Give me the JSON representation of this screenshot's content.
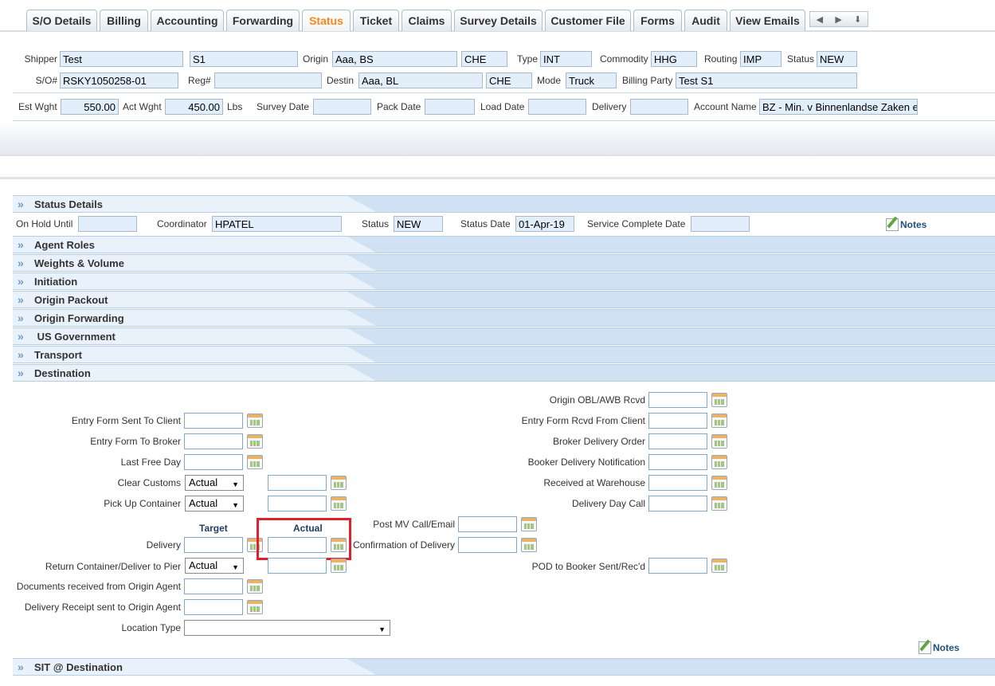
{
  "tabs": [
    {
      "label": "S/O Details",
      "active": false
    },
    {
      "label": "Billing",
      "active": false
    },
    {
      "label": "Accounting",
      "active": false
    },
    {
      "label": "Forwarding",
      "active": false
    },
    {
      "label": "Status",
      "active": true
    },
    {
      "label": "Ticket",
      "active": false
    },
    {
      "label": "Claims",
      "active": false
    },
    {
      "label": "Survey Details",
      "active": false
    },
    {
      "label": "Customer File",
      "active": false
    },
    {
      "label": "Forms",
      "active": false
    },
    {
      "label": "Audit",
      "active": false
    },
    {
      "label": "View Emails",
      "active": false
    }
  ],
  "nav": {
    "prev": "◀",
    "next": "▶",
    "down": "⬇"
  },
  "header": {
    "shipper_label": "Shipper",
    "shipper": "Test",
    "shipper2": "S1",
    "origin_label": "Origin",
    "origin": "Aaa, BS",
    "origin_country": "CHE",
    "type_label": "Type",
    "type": "INT",
    "commodity_label": "Commodity",
    "commodity": "HHG",
    "routing_label": "Routing",
    "routing": "IMP",
    "status_label": "Status",
    "status": "NEW",
    "so_label": "S/O#",
    "so": "RSKY1050258-01",
    "reg_label": "Reg#",
    "reg": "",
    "destin_label": "Destin",
    "destin": "Aaa, BL",
    "destin_country": "CHE",
    "mode_label": "Mode",
    "mode": "Truck",
    "billing_party_label": "Billing Party",
    "billing_party": "Test S1",
    "est_wght_label": "Est Wght",
    "est_wght": "550.00",
    "act_wght_label": "Act Wght",
    "act_wght": "450.00",
    "lbs": "Lbs",
    "survey_date_label": "Survey Date",
    "pack_date_label": "Pack Date",
    "load_date_label": "Load Date",
    "delivery_label": "Delivery",
    "account_name_label": "Account Name",
    "account_name": "BZ - Min. v Binnenlandse Zaken e"
  },
  "status_details": {
    "title": "Status Details",
    "on_hold_label": "On Hold Until",
    "coordinator_label": "Coordinator",
    "coordinator": "HPATEL",
    "status_label": "Status",
    "status": "NEW",
    "status_date_label": "Status Date",
    "status_date": "01-Apr-19",
    "service_complete_label": "Service Complete Date",
    "notes": "Notes"
  },
  "sections": [
    "Agent Roles",
    "Weights & Volume",
    "Initiation",
    "Origin Packout",
    "Origin Forwarding",
    " US Government",
    "Transport",
    "Destination"
  ],
  "destination": {
    "left": {
      "entry_form_sent": "Entry Form Sent To Client",
      "entry_form_broker": "Entry Form To Broker",
      "last_free_day": "Last Free Day",
      "clear_customs": "Clear Customs",
      "pick_up_container": "Pick Up Container",
      "target_head": "Target",
      "actual_head": "Actual",
      "delivery": "Delivery",
      "return_container": "Return Container/Deliver to Pier",
      "docs_received": "Documents received from Origin Agent",
      "delivery_receipt": "Delivery Receipt sent to Origin Agent",
      "location_type": "Location Type",
      "select_actual": "Actual"
    },
    "middle": {
      "post_mv_call": "Post MV Call/Email",
      "confirmation_delivery": "Confirmation of Delivery"
    },
    "right": {
      "origin_obl": "Origin OBL/AWB Rcvd",
      "entry_form_rcvd": "Entry Form Rcvd From Client",
      "broker_delivery_order": "Broker Delivery Order",
      "booker_delivery_notification": "Booker Delivery Notification",
      "received_warehouse": "Received at Warehouse",
      "delivery_day_call": "Delivery Day Call",
      "pod_booker": "POD to Booker Sent/Rec'd"
    },
    "notes": "Notes"
  },
  "sit_destination": "SIT @ Destination"
}
